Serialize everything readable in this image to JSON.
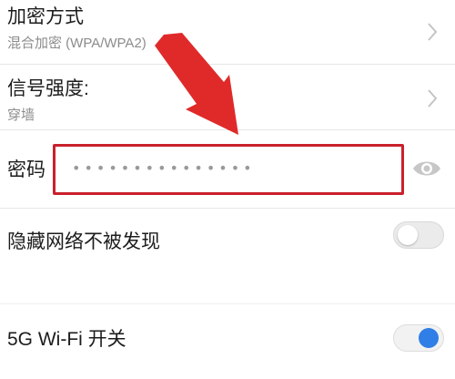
{
  "security": {
    "title": "加密方式",
    "value": "混合加密 (WPA/WPA2)"
  },
  "signal": {
    "title": "信号强度:",
    "value": "穿墙"
  },
  "password": {
    "label": "密码",
    "masked_value": "•••••••••••••••"
  },
  "hidden_network": {
    "label": "隐藏网络不被发现",
    "enabled": false
  },
  "wifi5g": {
    "label": "5G Wi-Fi 开关",
    "enabled": true
  },
  "colors": {
    "highlight": "#c9202c",
    "toggle_on": "#2f7fe6"
  },
  "icons": [
    "chevron-right-icon",
    "eye-icon",
    "arrow-annotation"
  ]
}
